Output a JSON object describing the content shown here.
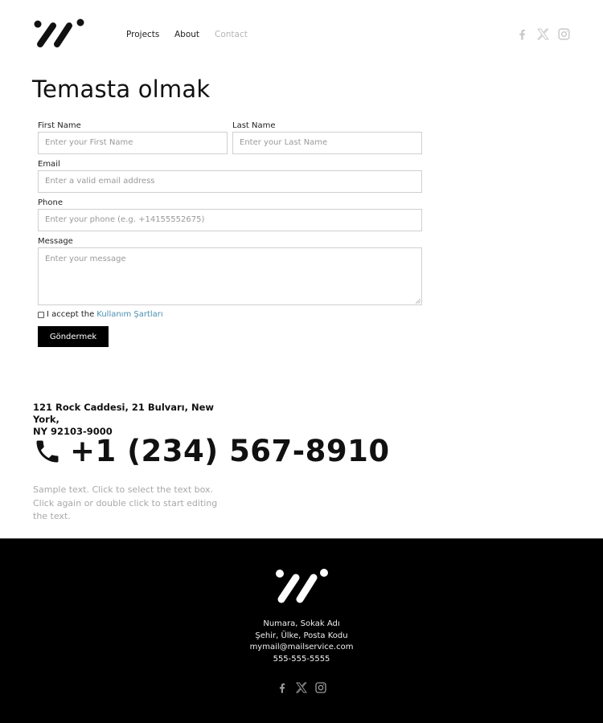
{
  "header": {
    "logo": "brand-logo",
    "nav": [
      {
        "label": "Projects",
        "active": false
      },
      {
        "label": "About",
        "active": false
      },
      {
        "label": "Contact",
        "active": true
      }
    ],
    "social": [
      "facebook-icon",
      "x-icon",
      "instagram-icon"
    ],
    "social_color": "#c8c8c8"
  },
  "page": {
    "title": "Temasta olmak"
  },
  "form": {
    "first_name": {
      "label": "First Name",
      "value": "",
      "placeholder": "Enter your First Name"
    },
    "last_name": {
      "label": "Last Name",
      "value": "",
      "placeholder": "Enter your Last Name"
    },
    "email": {
      "label": "Email",
      "value": "",
      "placeholder": "Enter a valid email address"
    },
    "phone": {
      "label": "Phone",
      "value": "",
      "placeholder": "Enter your phone (e.g. +14155552675)"
    },
    "message": {
      "label": "Message",
      "value": "",
      "placeholder": "Enter your message"
    },
    "accept": {
      "text": "I accept the",
      "link": "Kullanım Şartları",
      "checked": false,
      "link_color": "#4a8fb0"
    },
    "submit_label": "Göndermek"
  },
  "contact": {
    "address_line1": "121 Rock Caddesi, 21 Bulvarı, New York,",
    "address_line2": "NY 92103-9000",
    "phone": "+1 (234) 567-8910",
    "sample_text": "Sample text. Click to select the text box. Click again or double click to start editing the text."
  },
  "footer": {
    "background": "#000000",
    "lines": [
      "Numara, Sokak Adı",
      "Şehir, Ülke, Posta Kodu",
      "mymail@mailservice.com",
      "555-555-5555"
    ],
    "social": [
      "facebook-icon",
      "x-icon",
      "instagram-icon"
    ]
  }
}
